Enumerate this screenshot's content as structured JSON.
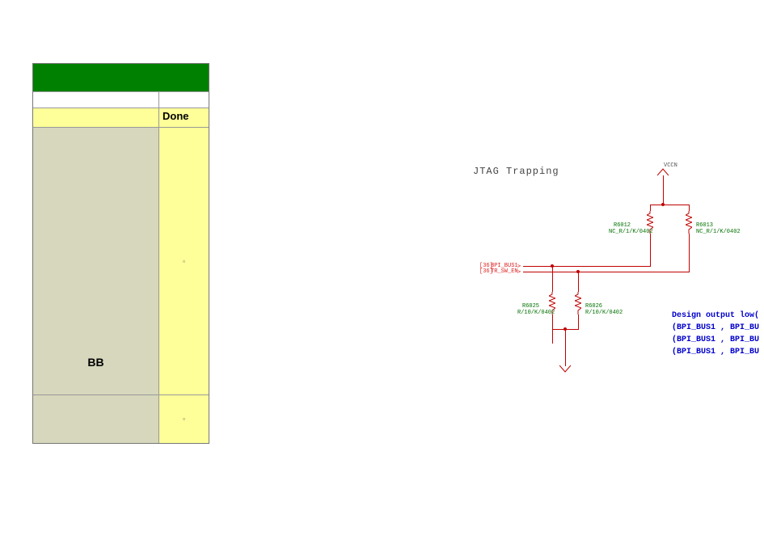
{
  "table": {
    "done_label": "Done",
    "bb_label": "BB",
    "box_glyph1": "▫",
    "box_glyph2": "▫"
  },
  "schematic": {
    "title": "JTAG Trapping",
    "vcc": "VCCN",
    "r_top_left": {
      "ref": "R6012",
      "val": "NC_R/1/K/0402"
    },
    "r_top_right": {
      "ref": "R6013",
      "val": "NC_R/1/K/0402"
    },
    "r_bot_left": {
      "ref": "R6025",
      "val": "R/10/K/0402"
    },
    "r_bot_right": {
      "ref": "R6026",
      "val": "R/10/K/0402"
    },
    "pin1": {
      "num": "[36]",
      "name": "BPI_BUS1"
    },
    "pin2": {
      "num": "[36]",
      "name": "TR_SW_EN"
    },
    "bracket_l": "≻",
    "bracket_r": "≻",
    "note_line1": "Design output low(",
    "note_line2": "(BPI_BUS1 , BPI_BU",
    "note_line3": "(BPI_BUS1 , BPI_BU",
    "note_line4": "(BPI_BUS1 , BPI_BU"
  }
}
